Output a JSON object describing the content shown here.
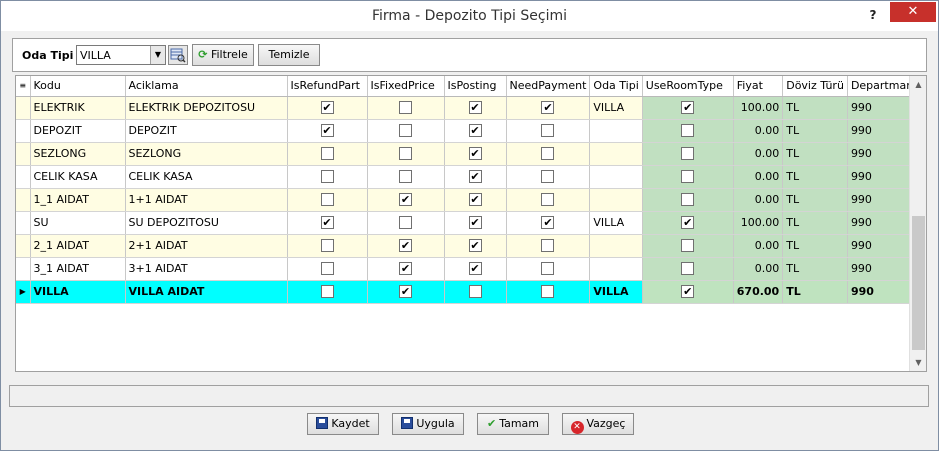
{
  "window": {
    "title": "Firma - Depozito Tipi Seçimi",
    "help_label": "?",
    "close_label": "✕"
  },
  "filter": {
    "label": "Oda Tipi",
    "value": "VILLA",
    "filter_label": "Filtrele",
    "clear_label": "Temizle"
  },
  "grid": {
    "columns": [
      "Kodu",
      "Aciklama",
      "IsRefundPart",
      "IsFixedPrice",
      "IsPosting",
      "NeedPayment",
      "Oda Tipi",
      "UseRoomType",
      "Fiyat",
      "Döviz Türü",
      "Departman"
    ],
    "rows": [
      {
        "kodu": "ELEKTRIK",
        "aciklama": "ELEKTRIK DEPOZITOSU",
        "refund": true,
        "fixed": false,
        "posting": true,
        "need": true,
        "oda": "VILLA",
        "use": true,
        "fiyat": "100.00",
        "doviz": "TL",
        "dept": "990"
      },
      {
        "kodu": "DEPOZIT",
        "aciklama": "DEPOZIT",
        "refund": true,
        "fixed": false,
        "posting": true,
        "need": false,
        "oda": "",
        "use": false,
        "fiyat": "0.00",
        "doviz": "TL",
        "dept": "990"
      },
      {
        "kodu": "SEZLONG",
        "aciklama": "SEZLONG",
        "refund": false,
        "fixed": false,
        "posting": true,
        "need": false,
        "oda": "",
        "use": false,
        "fiyat": "0.00",
        "doviz": "TL",
        "dept": "990"
      },
      {
        "kodu": "CELIK KASA",
        "aciklama": "CELIK KASA",
        "refund": false,
        "fixed": false,
        "posting": true,
        "need": false,
        "oda": "",
        "use": false,
        "fiyat": "0.00",
        "doviz": "TL",
        "dept": "990"
      },
      {
        "kodu": "1_1 AIDAT",
        "aciklama": "1+1 AIDAT",
        "refund": false,
        "fixed": true,
        "posting": true,
        "need": false,
        "oda": "",
        "use": false,
        "fiyat": "0.00",
        "doviz": "TL",
        "dept": "990"
      },
      {
        "kodu": "SU",
        "aciklama": "SU DEPOZITOSU",
        "refund": true,
        "fixed": false,
        "posting": true,
        "need": true,
        "oda": "VILLA",
        "use": true,
        "fiyat": "100.00",
        "doviz": "TL",
        "dept": "990"
      },
      {
        "kodu": "2_1 AIDAT",
        "aciklama": "2+1 AIDAT",
        "refund": false,
        "fixed": true,
        "posting": true,
        "need": false,
        "oda": "",
        "use": false,
        "fiyat": "0.00",
        "doviz": "TL",
        "dept": "990"
      },
      {
        "kodu": "3_1 AIDAT",
        "aciklama": "3+1  AIDAT",
        "refund": false,
        "fixed": true,
        "posting": true,
        "need": false,
        "oda": "",
        "use": false,
        "fiyat": "0.00",
        "doviz": "TL",
        "dept": "990"
      },
      {
        "kodu": "VILLA",
        "aciklama": "VILLA  AIDAT",
        "refund": false,
        "fixed": true,
        "posting": false,
        "need": false,
        "oda": "VILLA",
        "use": true,
        "fiyat": "670.00",
        "doviz": "TL",
        "dept": "990",
        "selected": true
      }
    ]
  },
  "buttons": {
    "save": "Kaydet",
    "apply": "Uygula",
    "ok": "Tamam",
    "cancel": "Vazgeç"
  }
}
